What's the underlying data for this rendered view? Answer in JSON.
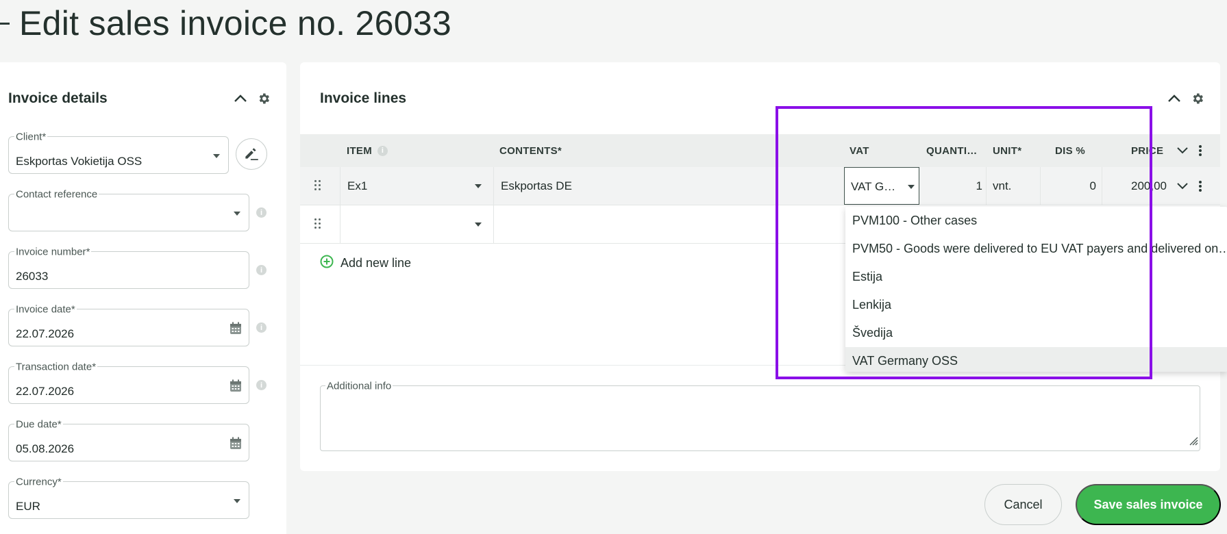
{
  "page": {
    "title": "Edit sales invoice no. 26033"
  },
  "details": {
    "heading": "Invoice details",
    "client": {
      "label": "Client",
      "value": "Eskportas Vokietija OSS"
    },
    "contact": {
      "label": "Contact reference",
      "value": ""
    },
    "invoice_number": {
      "label": "Invoice number",
      "value": "26033"
    },
    "invoice_date": {
      "label": "Invoice date",
      "value": "22.07.2026"
    },
    "transaction_date": {
      "label": "Transaction date",
      "value": "22.07.2026"
    },
    "due_date": {
      "label": "Due date",
      "value": "05.08.2026"
    },
    "currency": {
      "label": "Currency",
      "value": "EUR"
    },
    "required_mark": "*"
  },
  "lines": {
    "heading": "Invoice lines",
    "columns": {
      "item": "ITEM",
      "contents": "CONTENTS",
      "vat": "VAT",
      "quantity": "QUANTI…",
      "unit": "UNIT",
      "discount": "DIS %",
      "price": "PRICE"
    },
    "rows": [
      {
        "item": "Ex1",
        "contents": "Eskportas DE",
        "vat": "VAT G…",
        "quantity": "1",
        "unit": "vnt.",
        "discount": "0",
        "price": "200,00"
      },
      {
        "item": "",
        "contents": "",
        "vat": "",
        "quantity": "",
        "unit": "",
        "discount": "",
        "price": ""
      }
    ],
    "add_line": "Add new line",
    "additional_info_label": "Additional info"
  },
  "vat_dropdown": {
    "options": [
      "PVM100 - Other cases",
      "PVM50 - Goods were delivered to EU VAT payers and delivered on…",
      "Estija",
      "Lenkija",
      "Švedija",
      "VAT Germany OSS"
    ],
    "highlighted": "VAT Germany OSS"
  },
  "actions": {
    "cancel": "Cancel",
    "save": "Save sales invoice"
  },
  "colors": {
    "primary": "#3db650",
    "highlight_box": "#8a0fe8",
    "text": "#24312d"
  },
  "icons": [
    "collapse-icon",
    "gear-icon",
    "pencil-icon",
    "info-icon",
    "calendar-icon",
    "drag-handle-icon",
    "add-circle-icon",
    "more-vert-icon",
    "chevron-down-icon",
    "resize-icon"
  ]
}
